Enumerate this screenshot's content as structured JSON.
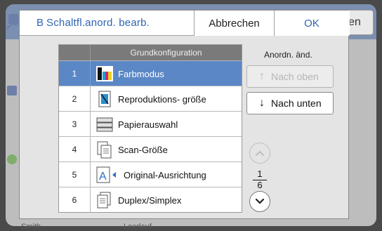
{
  "background": {
    "right_button_label": "en",
    "bottom_left_text": "Smith",
    "bottom_center_text": "Leerlauf"
  },
  "dialog": {
    "title_prefix": "B",
    "title": "Schaltfl.anord. bearb.",
    "cancel_label": "Abbrechen",
    "ok_label": "OK"
  },
  "table": {
    "header": "Grundkonfiguration",
    "rows": [
      {
        "num": "1",
        "label": "Farbmodus",
        "icon": "color-mode-icon",
        "selected": true
      },
      {
        "num": "2",
        "label": "Reproduktions- größe",
        "icon": "reproduction-size-icon",
        "selected": false
      },
      {
        "num": "3",
        "label": "Papierauswahl",
        "icon": "paper-tray-icon",
        "selected": false
      },
      {
        "num": "4",
        "label": "Scan-Größe",
        "icon": "scan-size-icon",
        "selected": false
      },
      {
        "num": "5",
        "label": "Original-Ausrichtung",
        "icon": "original-orientation-icon",
        "selected": false
      },
      {
        "num": "6",
        "label": "Duplex/Simplex",
        "icon": "duplex-simplex-icon",
        "selected": false
      }
    ]
  },
  "controls": {
    "reorder_label": "Anordn. änd.",
    "move_up_label": "Nach oben",
    "move_down_label": "Nach unten",
    "page_current": "1",
    "page_total": "6"
  },
  "colors": {
    "accent": "#2e64b0",
    "selected_row": "#5b87c6"
  }
}
